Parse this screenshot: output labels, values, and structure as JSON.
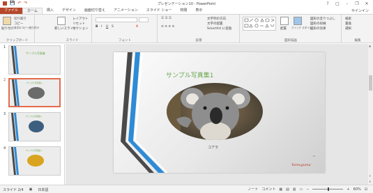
{
  "window": {
    "title": "プレゼンテーション10 - PowerPoint",
    "controls": [
      "?",
      "□",
      "–",
      "❐",
      "✕"
    ]
  },
  "qat": {
    "save": "💾",
    "undo": "↶",
    "redo": "↷"
  },
  "tabs": [
    "ファイル",
    "ホーム",
    "挿入",
    "デザイン",
    "画面切り替え",
    "アニメーション",
    "スライド ショー",
    "校閲",
    "表示"
  ],
  "signin": "サインイン",
  "ribbon": {
    "clipboard": {
      "paste": "貼り付け",
      "cut": "切り取り",
      "copy": "コピー",
      "format_painter": "書式のコピー/貼り付け",
      "label": "クリップボード"
    },
    "slides": {
      "new_slide": "新しいスライド",
      "layout": "レイアウト",
      "reset": "リセット",
      "section": "セクション",
      "label": "スライド"
    },
    "font": {
      "label": "フォント"
    },
    "paragraph": {
      "text_direction": "文字列の方向",
      "align_text": "文字の配置",
      "smartart": "SmartArt に変換",
      "label": "段落"
    },
    "drawing": {
      "arrange": "配置",
      "quick_styles": "クイック スタイル",
      "fill": "図形の塗りつぶし",
      "outline": "図形の枠線",
      "effects": "図形の効果",
      "label": "図形描画"
    },
    "editing": {
      "find": "検索",
      "replace": "置換",
      "select": "選択",
      "label": "編集"
    }
  },
  "thumbnails": [
    {
      "num": "1",
      "title": "サンプル写真集"
    },
    {
      "num": "2",
      "title": "サンプル写真集1"
    },
    {
      "num": "3",
      "title": "サンプル写真集2"
    },
    {
      "num": "4",
      "title": "サンプル写真集3"
    }
  ],
  "slide": {
    "title": "サンプル写真集1",
    "caption": "コアラ",
    "signature": "Yamaguma"
  },
  "status": {
    "slide_info": "スライド 2/4",
    "language": "日本語",
    "notes": "ノート",
    "comments": "コメント",
    "zoom": "60%"
  },
  "colors": {
    "accent": "#b7472a",
    "title_green": "#6aa84f",
    "stripe_blue": "#2e8bd6",
    "stripe_dark": "#4a4a4a"
  }
}
